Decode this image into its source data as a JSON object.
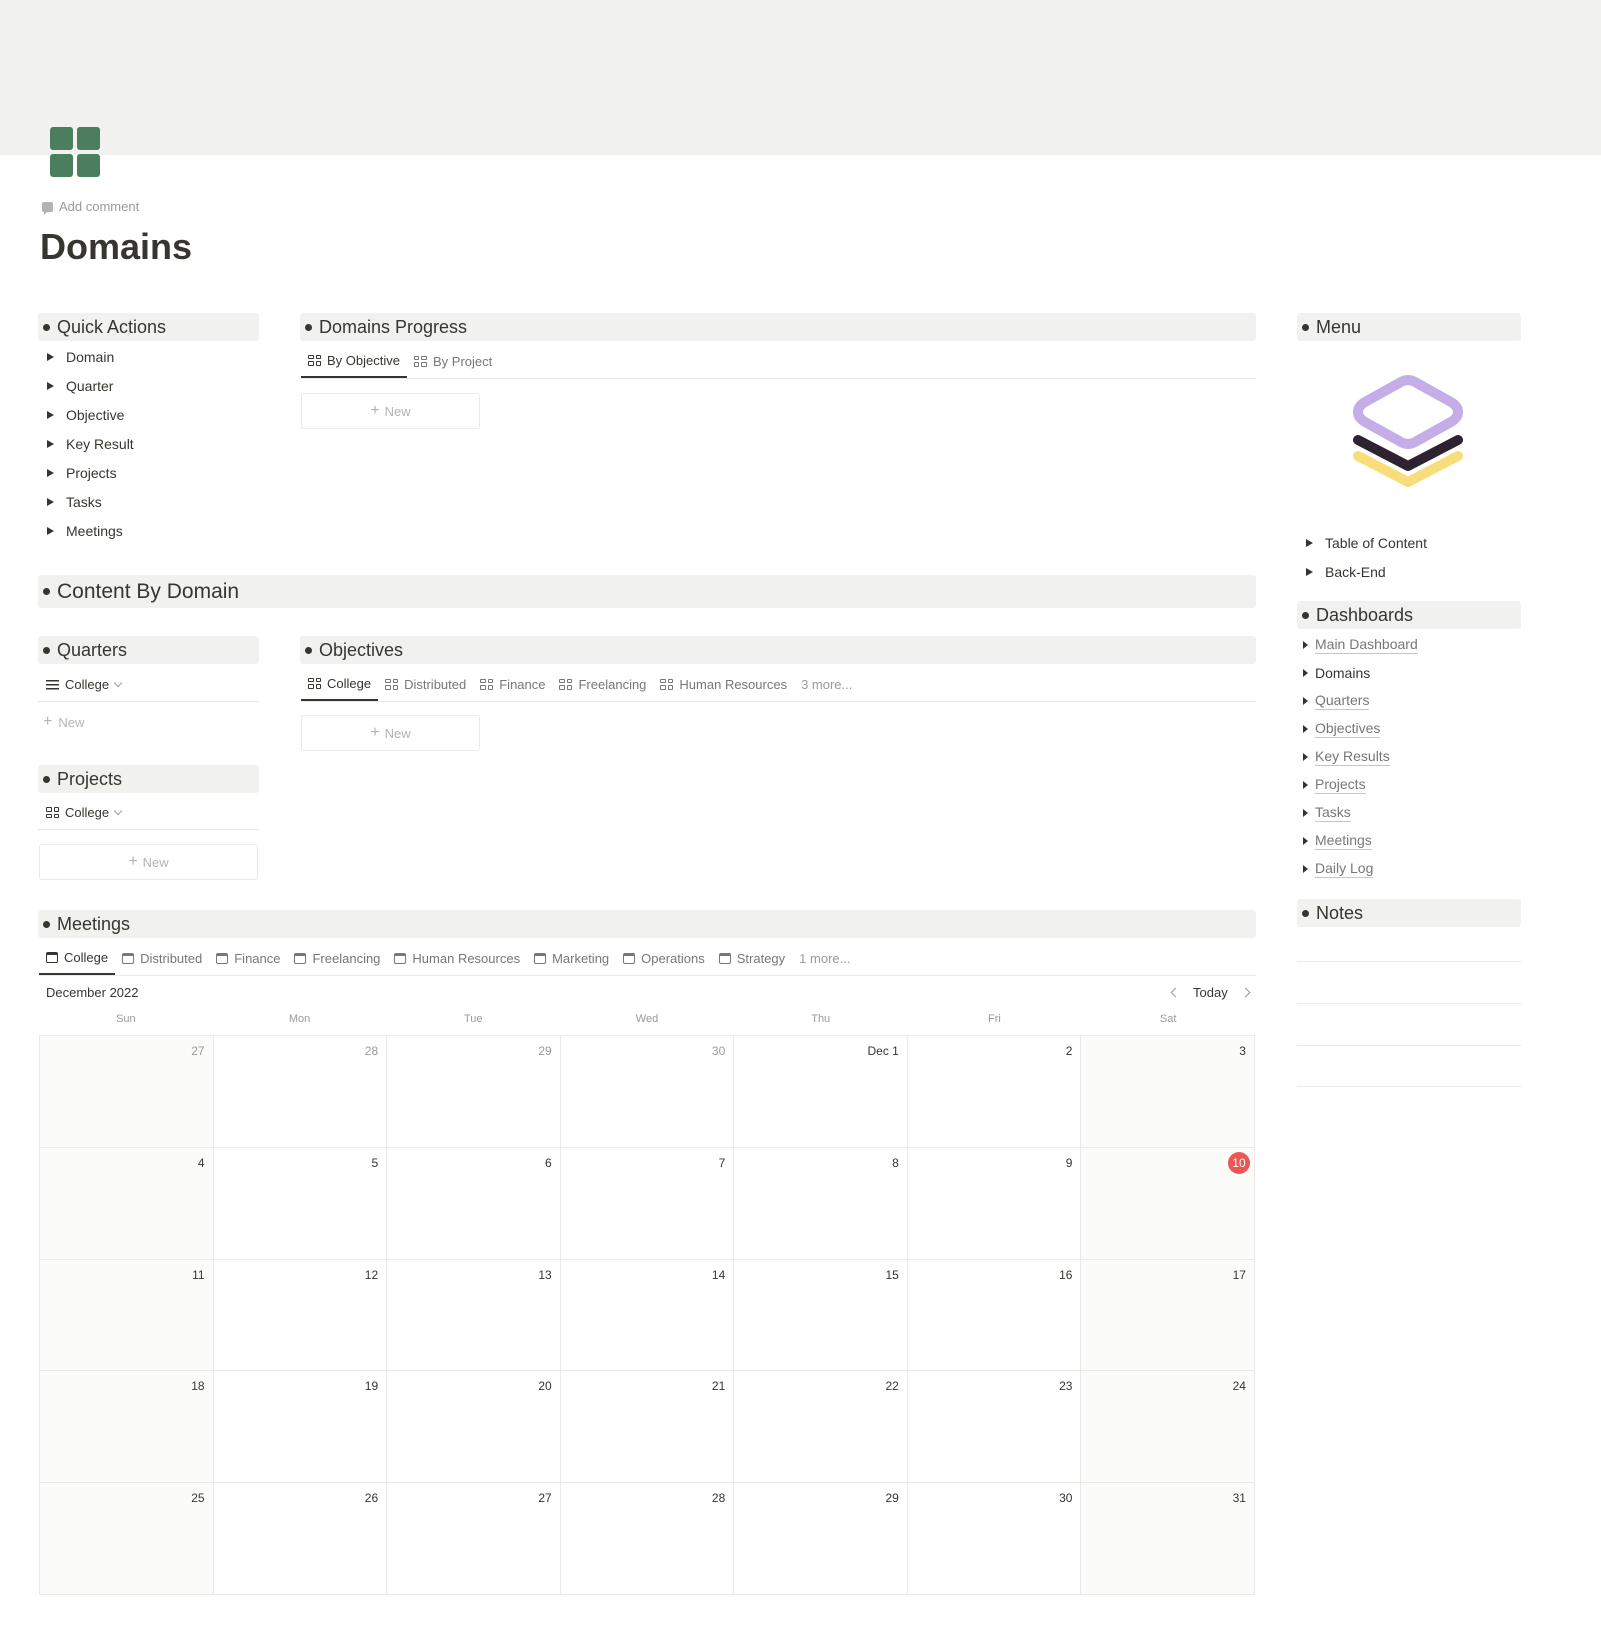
{
  "page": {
    "title": "Domains",
    "add_comment": "Add comment"
  },
  "quick_actions": {
    "title": "Quick Actions",
    "items": [
      "Domain",
      "Quarter",
      "Objective",
      "Key Result",
      "Projects",
      "Tasks",
      "Meetings"
    ]
  },
  "domains_progress": {
    "title": "Domains Progress",
    "tabs": [
      "By Objective",
      "By Project"
    ],
    "new_label": "New"
  },
  "menu": {
    "title": "Menu",
    "items": [
      "Table of Content",
      "Back-End"
    ]
  },
  "content_by_domain": {
    "title": "Content By Domain"
  },
  "quarters": {
    "title": "Quarters",
    "view": "College",
    "new_label": "New"
  },
  "projects": {
    "title": "Projects",
    "view": "College",
    "new_label": "New"
  },
  "objectives": {
    "title": "Objectives",
    "tabs": [
      "College",
      "Distributed",
      "Finance",
      "Freelancing",
      "Human Resources"
    ],
    "more": "3 more...",
    "new_label": "New"
  },
  "dashboards": {
    "title": "Dashboards",
    "items": [
      "Main Dashboard",
      "Domains",
      "Quarters",
      "Objectives",
      "Key Results",
      "Projects",
      "Tasks",
      "Meetings",
      "Daily Log"
    ]
  },
  "notes": {
    "title": "Notes"
  },
  "meetings": {
    "title": "Meetings",
    "tabs": [
      "College",
      "Distributed",
      "Finance",
      "Freelancing",
      "Human Resources",
      "Marketing",
      "Operations",
      "Strategy"
    ],
    "more": "1 more...",
    "month": "December 2022",
    "today_label": "Today",
    "weekdays": [
      "Sun",
      "Mon",
      "Tue",
      "Wed",
      "Thu",
      "Fri",
      "Sat"
    ],
    "days": [
      "27",
      "28",
      "29",
      "30",
      "Dec 1",
      "2",
      "3",
      "4",
      "5",
      "6",
      "7",
      "8",
      "9",
      "10",
      "11",
      "12",
      "13",
      "14",
      "15",
      "16",
      "17",
      "18",
      "19",
      "20",
      "21",
      "22",
      "23",
      "24",
      "25",
      "26",
      "27",
      "28",
      "29",
      "30",
      "31"
    ],
    "today": "10"
  },
  "colors": {
    "accent_green": "#4a7e5c",
    "today_red": "#eb5757",
    "logo_purple": "#c5aee8",
    "logo_dark": "#2d2230",
    "logo_yellow": "#f8dd7a"
  }
}
